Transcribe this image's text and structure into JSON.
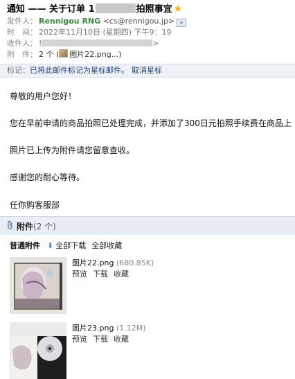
{
  "subject": {
    "prefix": "通知 —— 关于订单 1",
    "suffix": "拍照事宜"
  },
  "meta": {
    "from_label": "发件人：",
    "from_name": "Rennigou RNG",
    "from_email": "<cs@rennigou.jp>",
    "time_label": "时　间：",
    "time_value": "2022年11月10日 (星期四) 下午9：19",
    "to_label": "收件人：",
    "to_value": "!",
    "to_tail": ">",
    "attach_label": "附　件：",
    "attach_count": "2 个 (",
    "attach_chip": "图片22.png...)"
  },
  "markbar": {
    "label": "标记：",
    "text": "已将此邮件标记为星标邮件。",
    "action": "取消星标"
  },
  "body": {
    "greeting": "尊敬的用户您好！",
    "line1": "您在早前申请的商品拍照已处理完成，并添加了300日元拍照手续费在商品上",
    "line2": "照片已上传为附件请您留意查收。",
    "line3": "感谢您的耐心等待。",
    "signature": "任你购客服部"
  },
  "attachments": {
    "title": "附件",
    "count": "(2 个)",
    "section_label": "普通附件",
    "download_all": "全部下载",
    "save_all": "全部收藏",
    "files": [
      {
        "name": "图片22.png",
        "size": "(680.85K)",
        "preview": "预览",
        "download": "下载",
        "save": "收藏"
      },
      {
        "name": "图片23.png",
        "size": "(1.12M)",
        "preview": "预览",
        "download": "下载",
        "save": "收藏"
      }
    ]
  },
  "colors": {
    "sender_name": "#3a8b3a",
    "markbar_bg": "#eef2f7",
    "link": "#1e3f7a",
    "star": "#f0b400"
  }
}
